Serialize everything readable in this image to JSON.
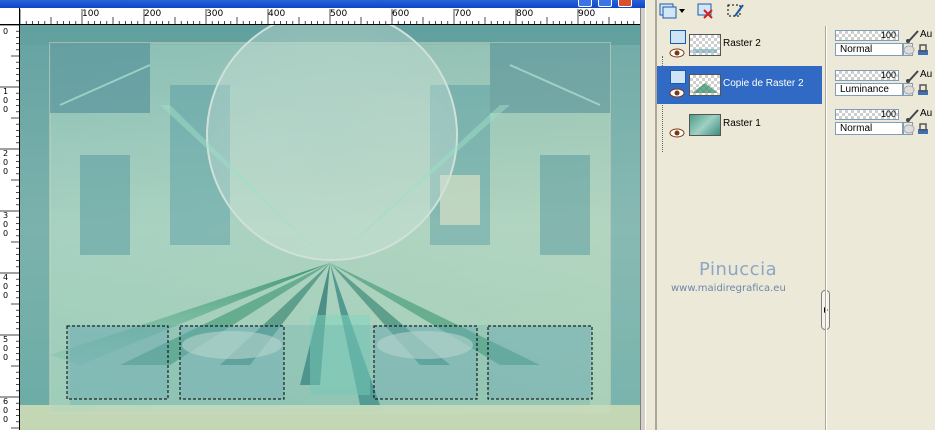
{
  "window": {
    "title": "",
    "colors": {
      "titlebar": "#0b46c8",
      "panel": "#ece9d8",
      "selection": "#316ac5"
    }
  },
  "rulers": {
    "horizontal_labels": [
      "100",
      "200",
      "300",
      "400",
      "500",
      "600",
      "700",
      "800",
      "900"
    ],
    "vertical_labels": [
      "0",
      "100",
      "200",
      "300",
      "400",
      "500",
      "600"
    ]
  },
  "canvas": {
    "description_icons": [
      "selection-marquee",
      "light-rays",
      "circle-overlay"
    ]
  },
  "toolbar": {
    "icons": [
      "new-layer-icon",
      "delete-layer-icon",
      "selection-layer-icon"
    ]
  },
  "layers": [
    {
      "name": "Raster 2",
      "opacity": "100",
      "blend": "Normal",
      "selected": false
    },
    {
      "name": "Copie de Raster 2",
      "opacity": "100",
      "blend": "Luminance",
      "selected": true
    },
    {
      "name": "Raster 1",
      "opacity": "100",
      "blend": "Normal",
      "selected": false
    }
  ],
  "props": {
    "au_label": "Au"
  },
  "watermark": {
    "name": "Pinuccia",
    "url": "www.maidiregrafica.eu"
  }
}
